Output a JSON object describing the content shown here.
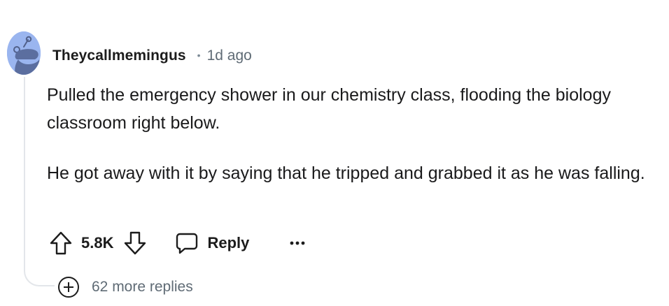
{
  "comment": {
    "author": "Theycallmemingus",
    "separator": "•",
    "time": "1d ago",
    "paragraphs": [
      "Pulled the emergency shower in our chemistry class, flooding the biology classroom right below.",
      "He got away with it by saying that he tripped and grabbed it as he was falling."
    ],
    "score": "5.8K",
    "reply_label": "Reply",
    "more_label": "…",
    "more_replies": "62 more replies"
  },
  "icons": {
    "avatar": "reddit-snoo-avatar-icon",
    "upvote": "arrow-up-icon",
    "downvote": "arrow-down-icon",
    "reply": "speech-bubble-icon",
    "more": "ellipsis-icon",
    "expand": "plus-circle-icon"
  },
  "colors": {
    "avatar_bg": "#9ab5ef",
    "text_primary": "#1c1c1c",
    "text_secondary": "#5f6b75",
    "thread_line": "#e3e6ea"
  }
}
